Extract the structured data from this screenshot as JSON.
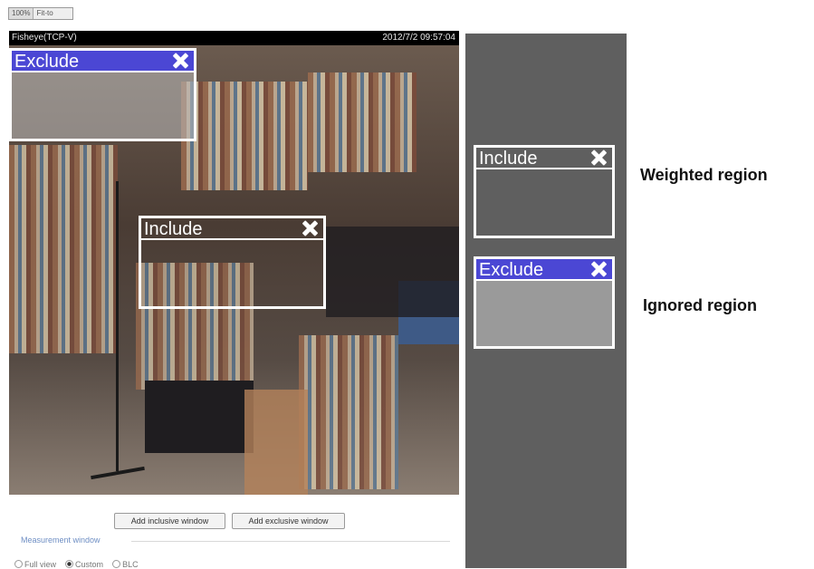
{
  "toolbar": {
    "zoom_left": "100%",
    "zoom_right": "Fit-to"
  },
  "video": {
    "title": "Fisheye(TCP-V)",
    "timestamp": "2012/7/2 09:57:04"
  },
  "regions": {
    "include_label": "Include",
    "exclude_label": "Exclude",
    "exclude_color": "#4b47d4",
    "close_icon": "close-x-icon"
  },
  "buttons": {
    "add_inclusive": "Add inclusive window",
    "add_exclusive": "Add exclusive window"
  },
  "measurement": {
    "label": "Measurement window",
    "options": [
      "Full view",
      "Custom",
      "BLC"
    ],
    "selected": "Custom"
  },
  "legend": {
    "include_label": "Include",
    "exclude_label": "Exclude",
    "weighted_text": "Weighted region",
    "ignored_text": "Ignored region",
    "panel_color": "#5f5f5f"
  }
}
